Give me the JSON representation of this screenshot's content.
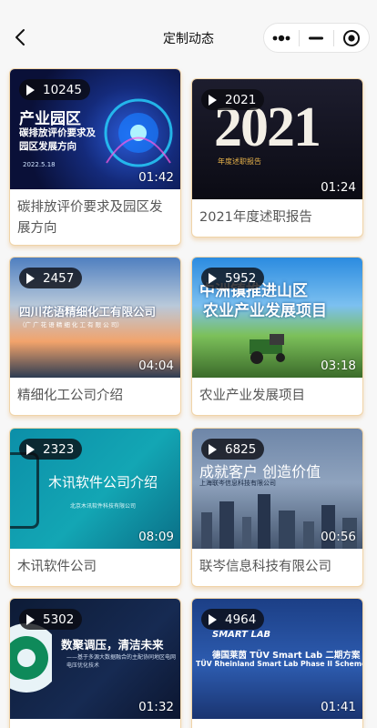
{
  "nav": {
    "title": "定制动态"
  },
  "videos": [
    {
      "title": "碳排放评价要求及园区发展方向",
      "views": "10245",
      "duration": "01:42",
      "thumb": {
        "heading": "产业园区",
        "subtitle": "碳排放评价要求及园区发展方向",
        "date": "2022.5.18"
      }
    },
    {
      "title": "2021年度述职报告",
      "views": "2021",
      "duration": "01:24",
      "thumb": {
        "heading": "2021",
        "subtitle": "年度述职报告"
      }
    },
    {
      "title": "精细化工公司介绍",
      "views": "2457",
      "duration": "04:04",
      "thumb": {
        "heading": "四川花语精细化工有限公司",
        "subtitle": "（广 广 花 语 精 细 化 工 有 限 公 司）"
      }
    },
    {
      "title": "农业产业发展项目",
      "views": "5952",
      "duration": "03:18",
      "thumb": {
        "heading": "中洲镇推进山区",
        "subtitle": "农业产业发展项目"
      }
    },
    {
      "title": "木讯软件公司",
      "views": "2323",
      "duration": "08:09",
      "thumb": {
        "heading": "木讯软件公司介绍",
        "subtitle": "北京木讯软件科技有限公司"
      }
    },
    {
      "title": "联岑信息科技有限公司",
      "views": "6825",
      "duration": "00:56",
      "thumb": {
        "heading": "成就客户  创造价值",
        "subtitle": "上海联岑信息科技有限公司"
      }
    },
    {
      "title": "",
      "views": "5302",
      "duration": "01:32",
      "thumb": {
        "heading": "数聚调压，清洁未来",
        "subtitle": "——基于多源大数据融合的主配协同地区电网电压优化技术"
      }
    },
    {
      "title": "",
      "views": "4964",
      "duration": "01:41",
      "thumb": {
        "heading": "德国莱茵 TÜV Smart Lab 二期方案",
        "subtitle": "TÜV Rheinland Smart Lab Phase II Scheme",
        "logo": "SMART LAB"
      }
    }
  ]
}
